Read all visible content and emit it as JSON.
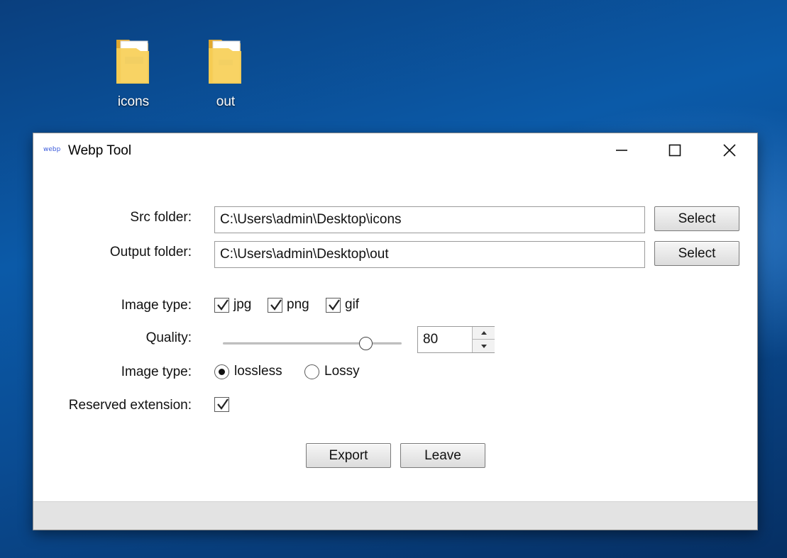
{
  "desktop": {
    "icons": [
      {
        "label": "icons",
        "icon": "folder-icon"
      },
      {
        "label": "out",
        "icon": "folder-icon"
      }
    ]
  },
  "window": {
    "title": "Webp Tool",
    "app_icon_text": "webp",
    "controls": [
      "minimize-icon",
      "maximize-icon",
      "close-icon"
    ]
  },
  "form": {
    "src_label": "Src folder:",
    "src_value": "C:\\Users\\admin\\Desktop\\icons",
    "output_label": "Output folder:",
    "output_value": "C:\\Users\\admin\\Desktop\\out",
    "select_label": "Select",
    "image_type_label": "Image type:",
    "types": [
      {
        "label": "jpg",
        "checked": true
      },
      {
        "label": "png",
        "checked": true
      },
      {
        "label": "gif",
        "checked": true
      }
    ],
    "quality_label": "Quality:",
    "quality_value": "80",
    "quality_level": 80,
    "compression_label": "Image type:",
    "compression_options": [
      {
        "label": "lossless",
        "selected": true
      },
      {
        "label": "Lossy",
        "selected": false
      }
    ],
    "reserved_label": "Reserved extension:",
    "reserved_checked": true,
    "export_label": "Export",
    "leave_label": "Leave"
  },
  "colors": {
    "desktop": "#0a4f94",
    "folder": "#f4c542",
    "app_icon": "#3b5bdb"
  }
}
